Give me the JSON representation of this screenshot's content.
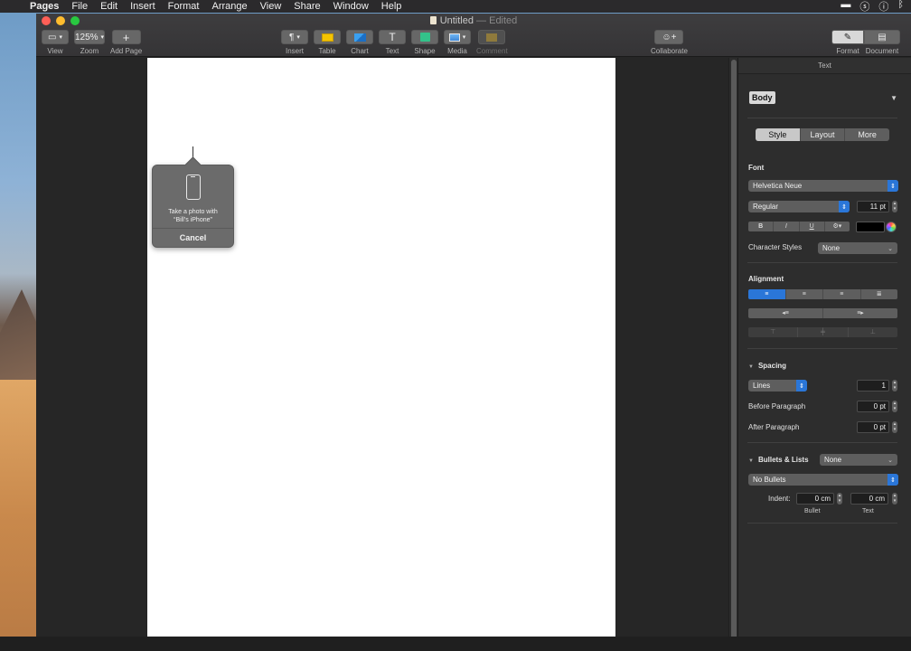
{
  "menubar": {
    "apple": "",
    "items": [
      "Pages",
      "File",
      "Edit",
      "Insert",
      "Format",
      "Arrange",
      "View",
      "Share",
      "Window",
      "Help"
    ]
  },
  "window": {
    "title": "Untitled",
    "title_suffix": "— Edited"
  },
  "toolbar": {
    "view_label": "View",
    "zoom_value": "125%",
    "zoom_label": "Zoom",
    "add_page_label": "Add Page",
    "insert_label": "Insert",
    "table_label": "Table",
    "chart_label": "Chart",
    "text_label": "Text",
    "shape_label": "Shape",
    "media_label": "Media",
    "comment_label": "Comment",
    "collaborate_label": "Collaborate",
    "format_label": "Format",
    "document_label": "Document"
  },
  "popover": {
    "message_line1": "Take a photo with",
    "message_line2": "“Bill’s iPhone”",
    "cancel_label": "Cancel"
  },
  "inspector": {
    "header": "Text",
    "paragraph_style": "Body",
    "tabs": [
      "Style",
      "Layout",
      "More"
    ],
    "active_tab": "Style",
    "font": {
      "section_label": "Font",
      "family": "Helvetica Neue",
      "typeface": "Regular",
      "size": "11 pt",
      "bold": "B",
      "italic": "I",
      "underline": "U",
      "gear": "⚙",
      "text_color": "#000000",
      "character_styles_label": "Character Styles",
      "character_styles_value": "None"
    },
    "alignment": {
      "section_label": "Alignment"
    },
    "spacing": {
      "section_label": "Spacing",
      "mode": "Lines",
      "line_value": "1",
      "before_label": "Before Paragraph",
      "before_value": "0 pt",
      "after_label": "After Paragraph",
      "after_value": "0 pt"
    },
    "bullets": {
      "section_label": "Bullets & Lists",
      "list_style": "None",
      "bullet_type": "No Bullets",
      "indent_label": "Indent:",
      "bullet_indent": "0 cm",
      "text_indent": "0 cm",
      "bullet_caption": "Bullet",
      "text_caption": "Text"
    }
  },
  "colors": {
    "accent": "#2a76d8",
    "panel": "#2d2d2d",
    "page": "#ffffff"
  }
}
